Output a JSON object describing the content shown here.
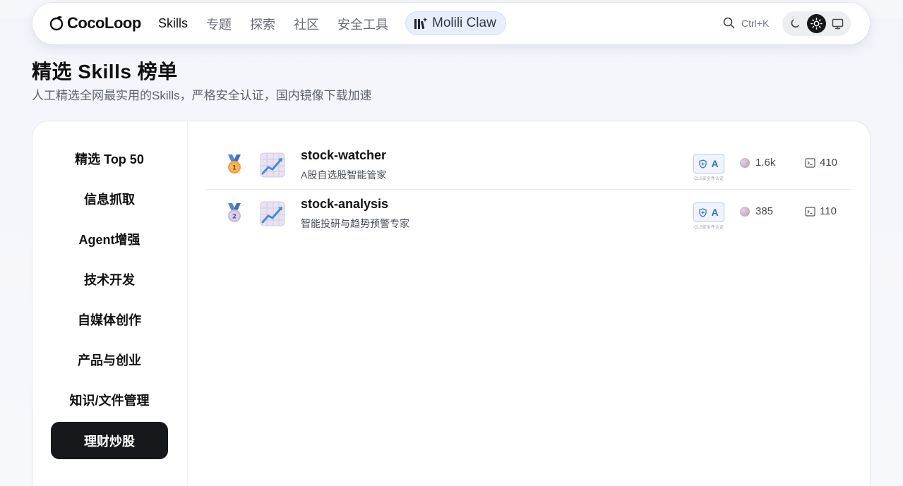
{
  "nav": {
    "logo": "CocoLoop",
    "links": [
      "Skills",
      "专题",
      "探索",
      "社区",
      "安全工具"
    ],
    "claw_label": "Molili Claw",
    "search_shortcut": "Ctrl+K"
  },
  "header": {
    "title": "精选 Skills 榜单",
    "subtitle": "人工精选全网最实用的Skills，严格安全认证，国内镜像下载加速"
  },
  "sidebar": {
    "items": [
      {
        "label": "精选 Top 50"
      },
      {
        "label": "信息抓取"
      },
      {
        "label": "Agent增强"
      },
      {
        "label": "技术开发"
      },
      {
        "label": "自媒体创作"
      },
      {
        "label": "产品与创业"
      },
      {
        "label": "知识/文件管理"
      },
      {
        "label": "理财炒股"
      }
    ],
    "active_index": 7
  },
  "skills": [
    {
      "rank": "1",
      "name": "stock-watcher",
      "desc": "A股自选股智能管家",
      "grade": "A",
      "badge_caption": "CLS安全件认证",
      "stars": "1.6k",
      "installs": "410"
    },
    {
      "rank": "2",
      "name": "stock-analysis",
      "desc": "智能投研与趋势预警专家",
      "grade": "A",
      "badge_caption": "CLS安全件认证",
      "stars": "385",
      "installs": "110"
    }
  ],
  "colors": {
    "accent_blue": "#2f6fd6",
    "active_dark": "#17181c",
    "medal_gold": "#f2a23a",
    "medal_silver": "#c9bde0"
  }
}
